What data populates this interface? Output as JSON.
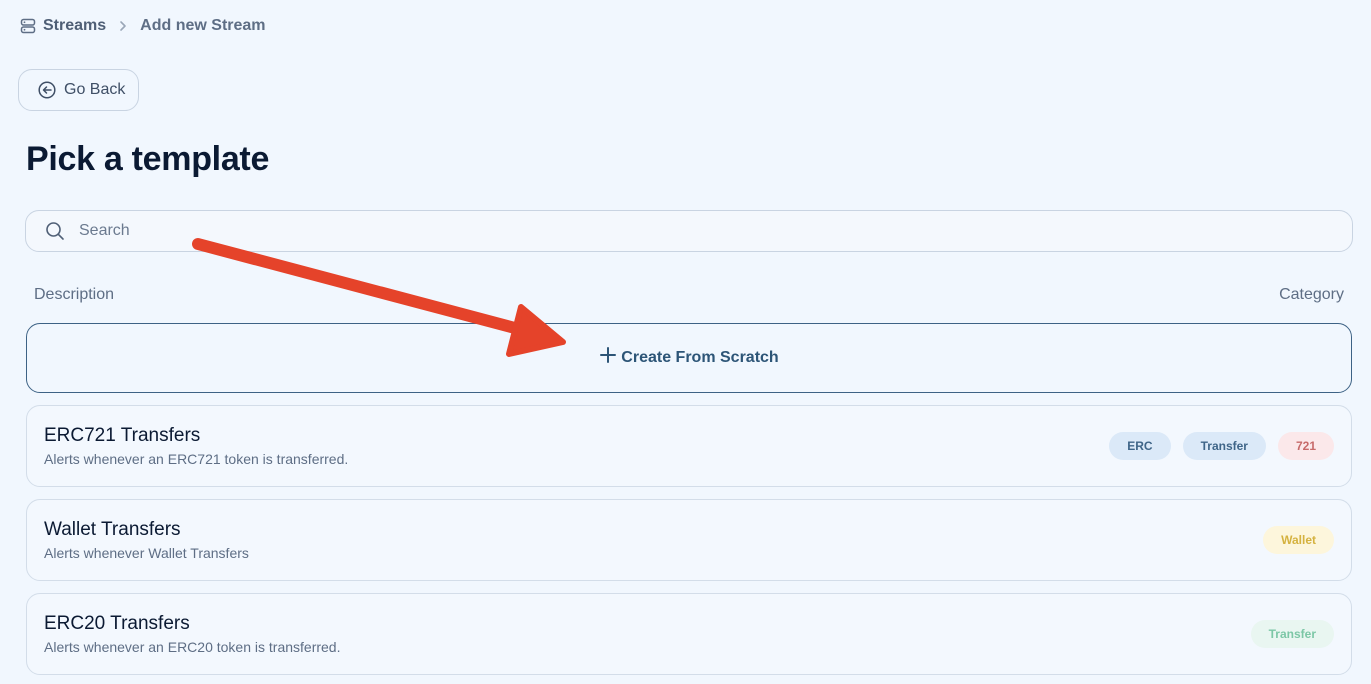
{
  "breadcrumb": {
    "icon": "server-stack-icon",
    "root": "Streams",
    "separator": "chevron-right-icon",
    "current": "Add new Stream"
  },
  "go_back": {
    "icon": "arrow-left-circle-icon",
    "label": "Go Back"
  },
  "title": "Pick a template",
  "search": {
    "icon": "search-icon",
    "placeholder": "Search",
    "value": ""
  },
  "columns": {
    "description": "Description",
    "category": "Category"
  },
  "create_scratch": {
    "icon": "plus-icon",
    "label": "Create From Scratch"
  },
  "templates": [
    {
      "title": "ERC721 Transfers",
      "description": "Alerts whenever an ERC721 token is transferred.",
      "tags": [
        {
          "label": "ERC",
          "bg": "#dbe9f8",
          "fg": "#3f6588"
        },
        {
          "label": "Transfer",
          "bg": "#dbe9f8",
          "fg": "#3f6588"
        },
        {
          "label": "721",
          "bg": "#fbe8ea",
          "fg": "#c76a6a"
        }
      ]
    },
    {
      "title": "Wallet Transfers",
      "description": "Alerts whenever Wallet Transfers",
      "tags": [
        {
          "label": "Wallet",
          "bg": "#fdf6dc",
          "fg": "#d5b23f"
        }
      ]
    },
    {
      "title": "ERC20 Transfers",
      "description": "Alerts whenever an ERC20 token is transferred.",
      "tags": [
        {
          "label": "Transfer",
          "bg": "#e9f6f1",
          "fg": "#7cc7a6"
        }
      ]
    }
  ],
  "annotation": {
    "icon": "red-arrow-icon",
    "color": "#e5432a"
  }
}
